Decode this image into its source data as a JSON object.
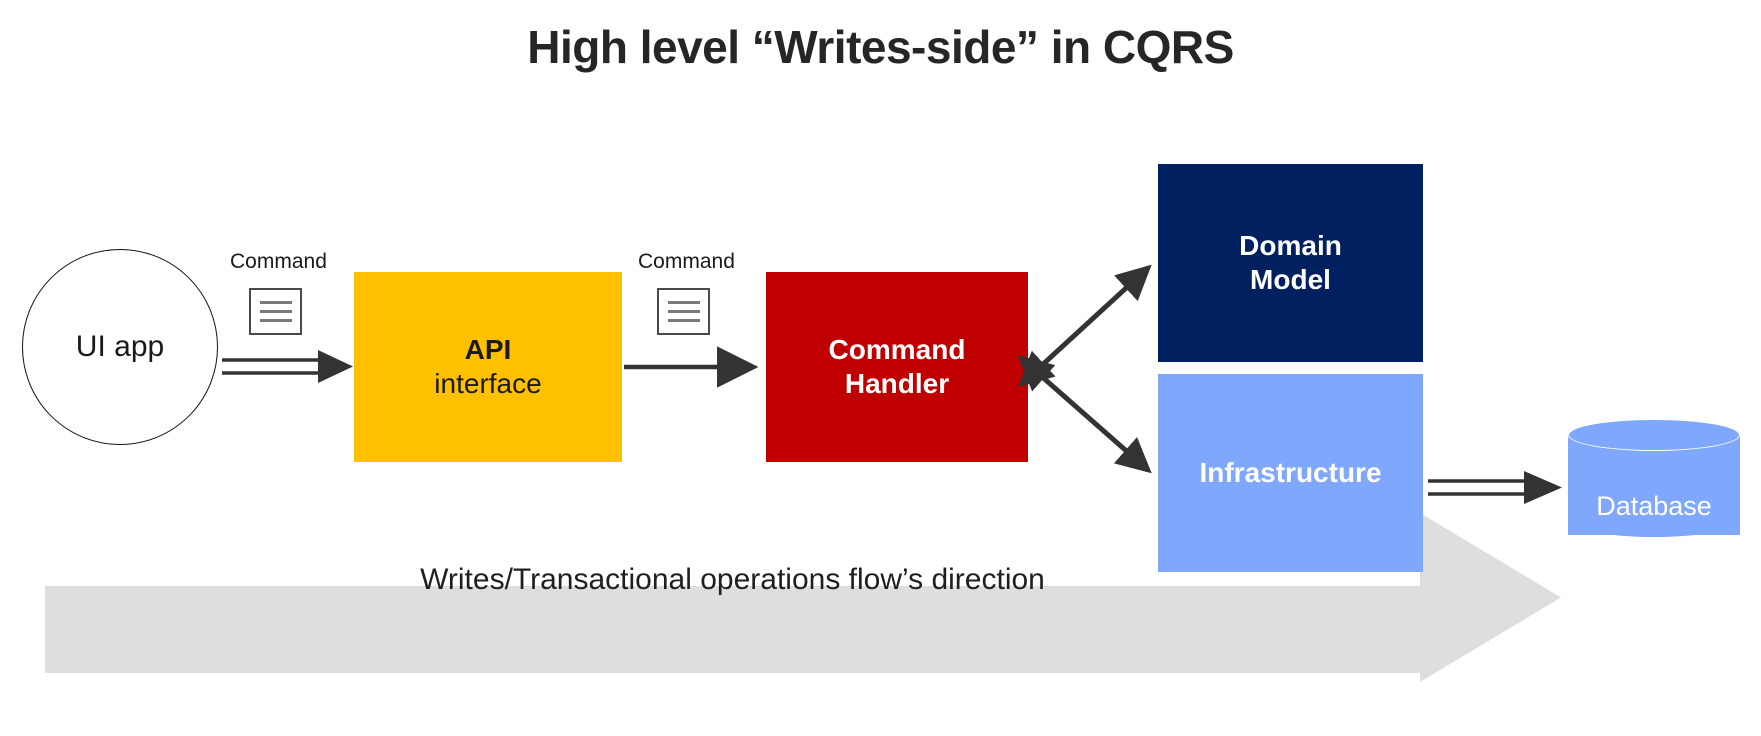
{
  "title": "High level “Writes-side” in CQRS",
  "nodes": {
    "ui_app": {
      "label": "UI app"
    },
    "api": {
      "line1": "API",
      "line2": "interface"
    },
    "command_handler": {
      "line1": "Command",
      "line2": "Handler"
    },
    "domain_model": {
      "line1": "Domain",
      "line2": "Model"
    },
    "infrastructure": {
      "label": "Infrastructure"
    },
    "database": {
      "label": "Database"
    }
  },
  "labels": {
    "command_1": "Command",
    "command_2": "Command",
    "flow_banner": "Writes/Transactional operations flow’s direction"
  },
  "colors": {
    "api_box": "#FFC000",
    "command_handler_box": "#C00000",
    "domain_model_box": "#002060",
    "infrastructure_box": "#7FA7FB",
    "database_cylinder": "#7FA7FB",
    "banner": "#DEDEDE",
    "arrow_stroke": "#333333",
    "title_text": "#262626",
    "background": "#FFFFFF"
  }
}
